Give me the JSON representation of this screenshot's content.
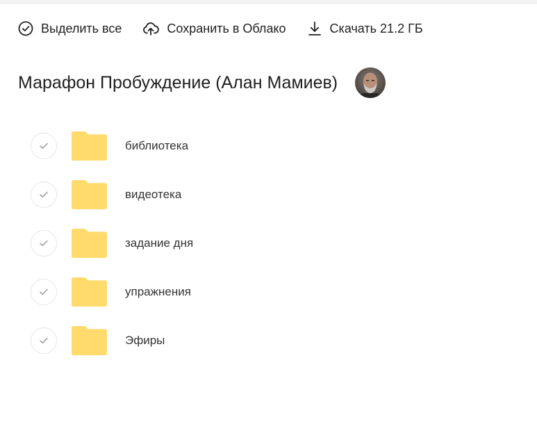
{
  "toolbar": {
    "select_all": {
      "label": "Выделить все",
      "icon": "check-circle-icon"
    },
    "save_to_cloud": {
      "label": "Сохранить в Облако",
      "icon": "cloud-upload-icon"
    },
    "download": {
      "label": "Скачать 21.2 ГБ",
      "icon": "download-icon"
    }
  },
  "header": {
    "title": "Марафон Пробуждение (Алан Мамиев)",
    "avatar": "owner-avatar"
  },
  "folders": [
    {
      "name": "библиотека",
      "icon": "folder-icon"
    },
    {
      "name": "видеотека",
      "icon": "folder-icon"
    },
    {
      "name": "задание дня",
      "icon": "folder-icon"
    },
    {
      "name": "упражнения",
      "icon": "folder-icon"
    },
    {
      "name": "Эфиры",
      "icon": "folder-icon"
    }
  ],
  "colors": {
    "folder": "#FFDB6E",
    "text": "#1f1f1f",
    "check_border": "#e6e6e6",
    "check_mark": "#9a9a9a"
  }
}
